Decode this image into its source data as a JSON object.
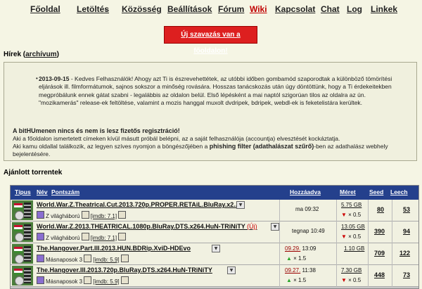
{
  "nav": {
    "home": "Főoldal",
    "download": "Letöltés",
    "community": "Közösség",
    "settings": "Beállítások",
    "forum": "Fórum",
    "wiki": "Wiki",
    "contact": "Kapcsolat",
    "chat": "Chat",
    "log": "Log",
    "links": "Linkek"
  },
  "vote_banner": "Új szavazás van a főoldalon!",
  "news": {
    "heading": "Hírek",
    "archive_link": "archívum",
    "date": "2013-09-15",
    "body": " - Kedves Felhasználók! Ahogy azt Ti is észrevehettétek, az utóbbi időben gombamód szaporodtak a különböző tömörítési eljárások ill. filmformátumok, sajnos sokszor a minőség rovására. Hosszas tanácskozás után úgy döntöttünk, hogy a Ti érdekeitekben megpróbálunk ennek gátat szabni - legalábbis az oldalon belül. Első lépésként a mai naptól szigorúan tilos az oldalra az ún. \"mozikamerás\" release-ek feltöltése, valamint a mozis hanggal muxolt dvdripek, bdripek, webdl-ek is feketelistára kerültek.",
    "warn_title": "A bitHUmenen nincs és nem is lesz fizetős regisztráció!",
    "warn_line1": "Aki a főoldalon ismertetett címeken kívül másutt próbál belépni, az a saját felhasználója (accountja) elvesztését kockáztatja.",
    "warn_line2a": "Aki kamu oldallal találkozik, az legyen szíves nyomjon a böngészőjében a ",
    "warn_bold": "phishing filter (adathalászat szűrő)",
    "warn_line2b": "-ben az adathalász webhely bejelentésére."
  },
  "torrents": {
    "heading": "Ajánlott torrentek",
    "columns": {
      "type": "Típus",
      "name": "Név",
      "score": "Pontszám",
      "added": "Hozzáadva",
      "size": "Méret",
      "seed": "Seed",
      "leech": "Leech"
    },
    "rows": [
      {
        "title": "World.War.Z.Theatrical.Cut.2013.720p.PROPER.RETAiL.BluRay.x2...",
        "new_tag": "",
        "category": "Z világháború",
        "imdb": "[imdb: 7.1]",
        "added": "ma 09:32",
        "size": "5.75 GB",
        "size_mult": "× 0.5",
        "seed": "80",
        "leech": "53"
      },
      {
        "title": "World.War.Z.2013.THEATRICAL.1080p.BluRay.DTS.x264.HuN-TRiNiTY",
        "new_tag": "(Új)",
        "category": "Z világháború",
        "imdb": "[imdb: 7.1]",
        "added": "tegnap 10:49",
        "size": "13.05 GB",
        "size_mult": "× 0.5",
        "seed": "390",
        "leech": "94"
      },
      {
        "title": "The.Hangover.Part.III.2013.HUN.BDRip.XviD-HDEvo",
        "new_tag": "",
        "category": "Másnaposok 3",
        "imdb": "[imdb: 5.9]",
        "added_date": "09.29.",
        "added_time": "13:09",
        "added_mult": "× 1.5",
        "size": "1.10 GB",
        "size_mult": "",
        "seed": "709",
        "leech": "122"
      },
      {
        "title": "The.Hangover.III.2013.720p.BluRay.DTS.x264.HuN-TRiNiTY",
        "new_tag": "",
        "category": "Másnaposok 3",
        "imdb": "[imdb: 5.9]",
        "added_date": "09.27.",
        "added_time": "11:38",
        "added_mult": "× 1.5",
        "size": "7.30 GB",
        "size_mult": "× 0.5",
        "seed": "448",
        "leech": "73"
      }
    ]
  }
}
